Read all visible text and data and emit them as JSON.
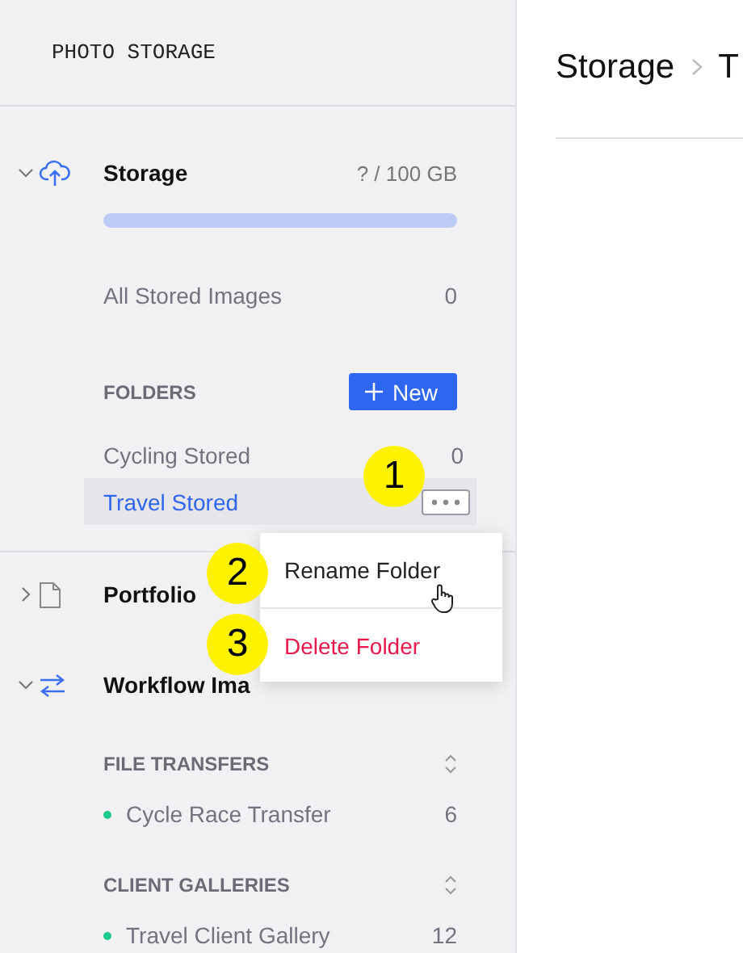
{
  "app_title": "PHOTO STORAGE",
  "storage": {
    "label": "Storage",
    "expanded": true,
    "usage": "? / 100 GB",
    "all_images": {
      "label": "All Stored Images",
      "count": "0"
    },
    "folders_heading": "FOLDERS",
    "new_button": "New",
    "folders": [
      {
        "name": "Cycling Stored",
        "count": "0",
        "selected": false
      },
      {
        "name": "Travel Stored",
        "selected": true
      }
    ]
  },
  "sections": [
    {
      "kind": "document",
      "label": "Portfolio",
      "expanded": false
    },
    {
      "kind": "transfer",
      "label": "Workflow Ima",
      "expanded": true,
      "groups": [
        {
          "heading": "FILE TRANSFERS",
          "items": [
            {
              "name": "Cycle Race Transfer",
              "count": "6",
              "color": "#1ec98c"
            }
          ]
        },
        {
          "heading": "CLIENT GALLERIES",
          "items": [
            {
              "name": "Travel Client Gallery",
              "count": "12",
              "color": "#1ec98c"
            }
          ]
        }
      ]
    }
  ],
  "context_menu": [
    {
      "label": "Rename Folder",
      "kind": "normal"
    },
    {
      "label": "Delete Folder",
      "kind": "danger"
    }
  ],
  "callouts": [
    "1",
    "2",
    "3"
  ],
  "breadcrumb": [
    "Storage",
    "T"
  ]
}
